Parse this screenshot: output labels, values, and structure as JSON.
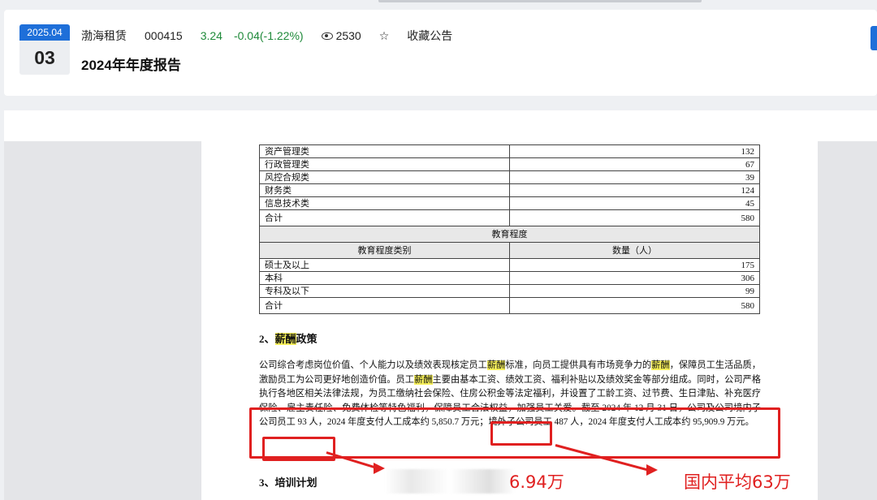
{
  "header": {
    "date_month": "2025.04",
    "date_day": "03",
    "company": "渤海租赁",
    "code": "000415",
    "price": "3.24",
    "change": "-0.04(-1.22%)",
    "views": "2530",
    "favorite_label": "收藏公告",
    "title": "2024年年度报告"
  },
  "doc": {
    "dept_rows": [
      {
        "label": "资产管理类",
        "value": "132"
      },
      {
        "label": "行政管理类",
        "value": "67"
      },
      {
        "label": "风控合规类",
        "value": "39"
      },
      {
        "label": "财务类",
        "value": "124"
      },
      {
        "label": "信息技术类",
        "value": "45"
      }
    ],
    "dept_total": {
      "label": "合计",
      "value": "580"
    },
    "edu_section_title": "教育程度",
    "edu_header": {
      "category": "教育程度类别",
      "count": "数量（人）"
    },
    "edu_rows": [
      {
        "label": "硕士及以上",
        "value": "175"
      },
      {
        "label": "本科",
        "value": "306"
      },
      {
        "label": "专科及以下",
        "value": "99"
      }
    ],
    "edu_total": {
      "label": "合计",
      "value": "580"
    },
    "sec2_prefix": "2、",
    "sec2_hl": "薪酬",
    "sec2_suffix": "政策",
    "para": [
      "公司综合考虑岗位价值、个人能力以及绩效表现核定员工",
      "薪酬",
      "标准，向员工提供具有市场竞争力的",
      "薪酬",
      "，保障员工生活品质，激励员工为公司更好地创造价值。员工",
      "薪酬",
      "主要由基本工资、绩效工资、福利补贴以及绩效奖金等部分组成。同时，公司严格执行各地区相关法律法规，为员工缴纳社会保险、住房公积金等法定福利，并设置了工龄工资、过节费、生日津贴、补充医疗保险、雇主责任险、免费体检等特色福利，保障员工合法权益，加强员工关爱。截至 2024 年 12 月 31 日，公司及公司境内子公司员工 93 人，2024 年度支付人工成本约 5,850.7 万元；境外子公司员工 487 人，2024 年度支付人工成本约 95,909.9 万元。"
    ],
    "sec3_title": "3、培训计划"
  },
  "annotations": {
    "domestic": "国内平均63万",
    "overseas_partial": "6.94万"
  }
}
